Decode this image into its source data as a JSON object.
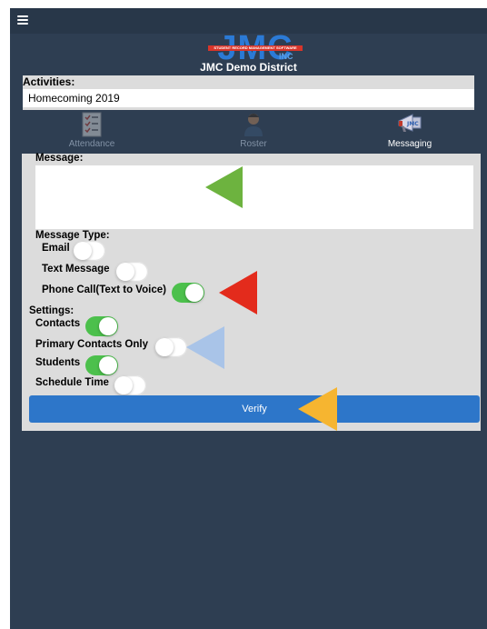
{
  "header": {
    "logo_text": "JMC",
    "logo_tagline": "STUDENT RECORD MANAGEMENT SOFTWARE",
    "logo_suffix": "INC",
    "district": "JMC Demo District"
  },
  "activities": {
    "label": "Activities:",
    "selected": "Homecoming 2019"
  },
  "tabs": [
    {
      "label": "Attendance",
      "icon": "checklist-icon",
      "active": false
    },
    {
      "label": "Roster",
      "icon": "person-icon",
      "active": false
    },
    {
      "label": "Messaging",
      "icon": "megaphone-icon",
      "active": true
    }
  ],
  "message": {
    "label": "Message:",
    "value": ""
  },
  "message_type": {
    "label": "Message Type:",
    "email": {
      "label": "Email",
      "on": false
    },
    "text_message": {
      "label": "Text Message",
      "on": false
    },
    "phone_call": {
      "label": "Phone Call(Text to Voice)",
      "on": true
    }
  },
  "settings": {
    "label": "Settings:",
    "contacts": {
      "label": "Contacts",
      "on": true
    },
    "primary_contacts_only": {
      "label": "Primary Contacts Only",
      "on": false
    },
    "students": {
      "label": "Students",
      "on": true
    },
    "schedule_time": {
      "label": "Schedule Time",
      "on": false
    }
  },
  "verify_label": "Verify",
  "colors": {
    "screen_bg": "#2e3e52",
    "panel_bg": "#dcdcdc",
    "toggle_on": "#4cc04c",
    "button": "#2d76c9",
    "arrow_green": "#6db33f",
    "arrow_red": "#e32b1c",
    "arrow_blue": "#a9c4e8",
    "arrow_orange": "#f6b530"
  }
}
